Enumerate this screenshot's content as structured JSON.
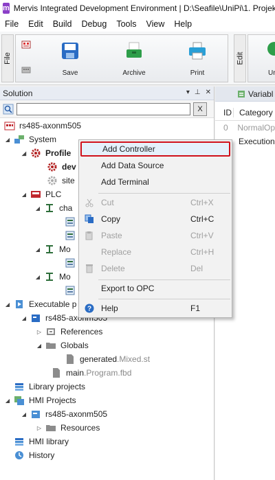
{
  "window": {
    "app_icon_letter": "m",
    "title": "Mervis Integrated Development Environment | D:\\Seafile\\UniPi\\1. Projek"
  },
  "menu": [
    "File",
    "Edit",
    "Build",
    "Debug",
    "Tools",
    "View",
    "Help"
  ],
  "ribbon": {
    "file_tab": "File",
    "edit_tab": "Edit",
    "save": "Save",
    "archive": "Archive",
    "print": "Print",
    "edit_partial": "Ur"
  },
  "solution": {
    "title": "Solution",
    "ctrl_menu": "▾",
    "ctrl_pin": "⊥",
    "ctrl_close": "✕",
    "search_value": "",
    "clear_label": "X",
    "tree": {
      "root": "rs485-axonm505",
      "system": "System",
      "profile": "Profile",
      "device_partial": "dev",
      "site_partial": "site",
      "plc": "PLC",
      "channel_partial": "cha",
      "mod1_partial": "Mo",
      "mod2_partial": "Mo",
      "executable_partial": "Executable p",
      "exec_project": "rs485-axonm505",
      "references": "References",
      "globals": "Globals",
      "generated_name": "generated",
      "generated_ext": ".Mixed.st",
      "main_name": "main",
      "main_ext": ".Program.fbd",
      "library_projects": "Library projects",
      "hmi_projects": "HMI Projects",
      "hmi_project": "rs485-axonm505",
      "resources": "Resources",
      "hmi_library": "HMI library",
      "history": "History"
    }
  },
  "right_panel": {
    "tab": "Variabl",
    "col_id": "ID",
    "col_category": "Category",
    "row0_id": "0",
    "row0_category": "NormalOp",
    "row1_category": "Execution"
  },
  "context_menu": {
    "add_controller": "Add Controller",
    "add_data_source": "Add Data Source",
    "add_terminal": "Add Terminal",
    "cut": "Cut",
    "cut_shortcut": "Ctrl+X",
    "copy": "Copy",
    "copy_shortcut": "Ctrl+C",
    "paste": "Paste",
    "paste_shortcut": "Ctrl+V",
    "replace": "Replace",
    "replace_shortcut": "Ctrl+H",
    "delete": "Delete",
    "delete_shortcut": "Del",
    "export": "Export to OPC",
    "help": "Help",
    "help_shortcut": "F1"
  },
  "colors": {
    "highlight_border": "#d0101a",
    "app_icon": "#8b3fc8",
    "folder": "#8c8c8c",
    "ribbon_save_blue": "#2a6cc4"
  }
}
